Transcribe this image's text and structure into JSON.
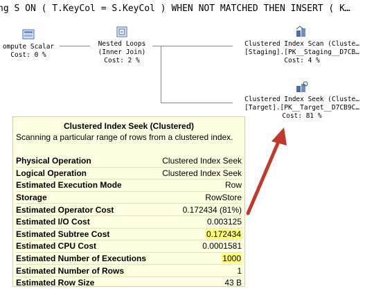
{
  "sql_text": "ng S ON ( T.KeyCol = S.KeyCol ) WHEN NOT MATCHED THEN INSERT ( K…",
  "operators": {
    "compute_scalar": {
      "title": "ompute Scalar",
      "cost": "Cost: 0 %"
    },
    "nested_loops": {
      "title": "Nested Loops",
      "subtitle": "(Inner Join)",
      "cost": "Cost: 2 %"
    },
    "clustered_index_scan": {
      "title": "Clustered Index Scan (Cluste…",
      "object": "[Staging].[PK__Staging__D7CB…",
      "cost": "Cost: 4 %"
    },
    "clustered_index_seek": {
      "title": "Clustered Index Seek (Cluste…",
      "object": "[Target].[PK__Target__D7CB9C…",
      "cost": "Cost: 81 %"
    }
  },
  "tooltip": {
    "title": "Clustered Index Seek (Clustered)",
    "description": "Scanning a particular range of rows from a clustered index.",
    "rows": [
      {
        "label": "Physical Operation",
        "value": "Clustered Index Seek"
      },
      {
        "label": "Logical Operation",
        "value": "Clustered Index Seek"
      },
      {
        "label": "Estimated Execution Mode",
        "value": "Row"
      },
      {
        "label": "Storage",
        "value": "RowStore"
      },
      {
        "label": "Estimated Operator Cost",
        "value": "0.172434 (81%)"
      },
      {
        "label": "Estimated I/O Cost",
        "value": "0.003125"
      },
      {
        "label": "Estimated Subtree Cost",
        "value": "0.172434"
      },
      {
        "label": "Estimated CPU Cost",
        "value": "0.0001581"
      },
      {
        "label": "Estimated Number of Executions",
        "value": "1000"
      },
      {
        "label": "Estimated Number of Rows",
        "value": "1"
      },
      {
        "label": "Estimated Row Size",
        "value": "43 B"
      }
    ]
  },
  "colors": {
    "arrow": "#c0392b",
    "highlight": "#ffff66",
    "tooltip_bg": "#ffffe1"
  }
}
